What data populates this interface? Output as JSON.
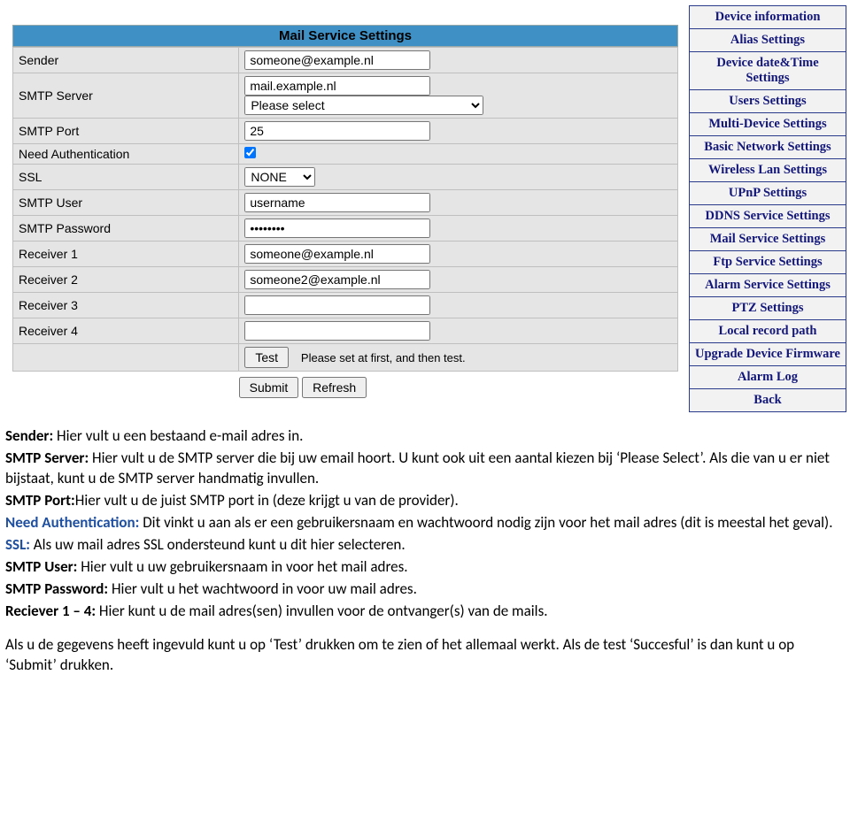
{
  "panel": {
    "title": "Mail Service Settings",
    "rows": {
      "sender": {
        "label": "Sender",
        "value": "someone@example.nl"
      },
      "smtp_server": {
        "label": "SMTP Server",
        "value": "mail.example.nl",
        "select_placeholder": "Please select"
      },
      "smtp_port": {
        "label": "SMTP Port",
        "value": "25"
      },
      "need_auth": {
        "label": "Need Authentication",
        "checked": true
      },
      "ssl": {
        "label": "SSL",
        "value": "NONE"
      },
      "smtp_user": {
        "label": "SMTP User",
        "value": "username"
      },
      "smtp_password": {
        "label": "SMTP Password",
        "value": "••••••••"
      },
      "receiver1": {
        "label": "Receiver 1",
        "value": "someone@example.nl"
      },
      "receiver2": {
        "label": "Receiver 2",
        "value": "someone2@example.nl"
      },
      "receiver3": {
        "label": "Receiver 3",
        "value": ""
      },
      "receiver4": {
        "label": "Receiver 4",
        "value": ""
      },
      "test_hint": "Please set at first, and then test.",
      "test_btn": "Test",
      "submit_btn": "Submit",
      "refresh_btn": "Refresh"
    }
  },
  "nav": {
    "items": [
      "Device information",
      "Alias Settings",
      "Device date&Time Settings",
      "Users Settings",
      "Multi-Device Settings",
      "Basic Network Settings",
      "Wireless Lan Settings",
      "UPnP Settings",
      "DDNS Service Settings",
      "Mail Service Settings",
      "Ftp Service Settings",
      "Alarm Service Settings",
      "PTZ Settings",
      "Local record path",
      "Upgrade Device Firmware",
      "Alarm Log",
      "Back"
    ]
  },
  "doc": {
    "p1_bold": "Sender:",
    "p1_rest": " Hier vult u een bestaand e-mail adres in.",
    "p2_bold": "SMTP Server:",
    "p2_rest": " Hier vult u de SMTP server die bij uw email hoort. U kunt ook uit een aantal kiezen bij ‘Please Select’. Als die van u er niet bijstaat, kunt u de SMTP server handmatig invullen.",
    "p3_bold": "SMTP Port:",
    "p3_rest": "Hier vult u de juist SMTP port in (deze krijgt u van de provider).",
    "p4_bold": "Need Authentication:",
    "p4_rest": " Dit vinkt u aan als er een gebruikersnaam en wachtwoord nodig zijn voor het mail adres (dit is meestal het geval).",
    "p5_bold": "SSL:",
    "p5_rest": " Als uw mail adres SSL ondersteund kunt u dit hier selecteren.",
    "p6_bold": "SMTP User:",
    "p6_rest": " Hier vult u uw gebruikersnaam in voor het mail adres.",
    "p7_bold": "SMTP Password:",
    "p7_rest": " Hier vult u het wachtwoord in voor uw mail adres.",
    "p8_bold": "Reciever 1 – 4:",
    "p8_rest": " Hier kunt u de mail adres(sen) invullen voor de ontvanger(s) van de mails.",
    "p9": "Als u de gegevens heeft ingevuld kunt u op ‘Test’ drukken om te zien of het allemaal werkt. Als de test ‘Succesful’ is dan kunt u op ‘Submit’ drukken."
  }
}
